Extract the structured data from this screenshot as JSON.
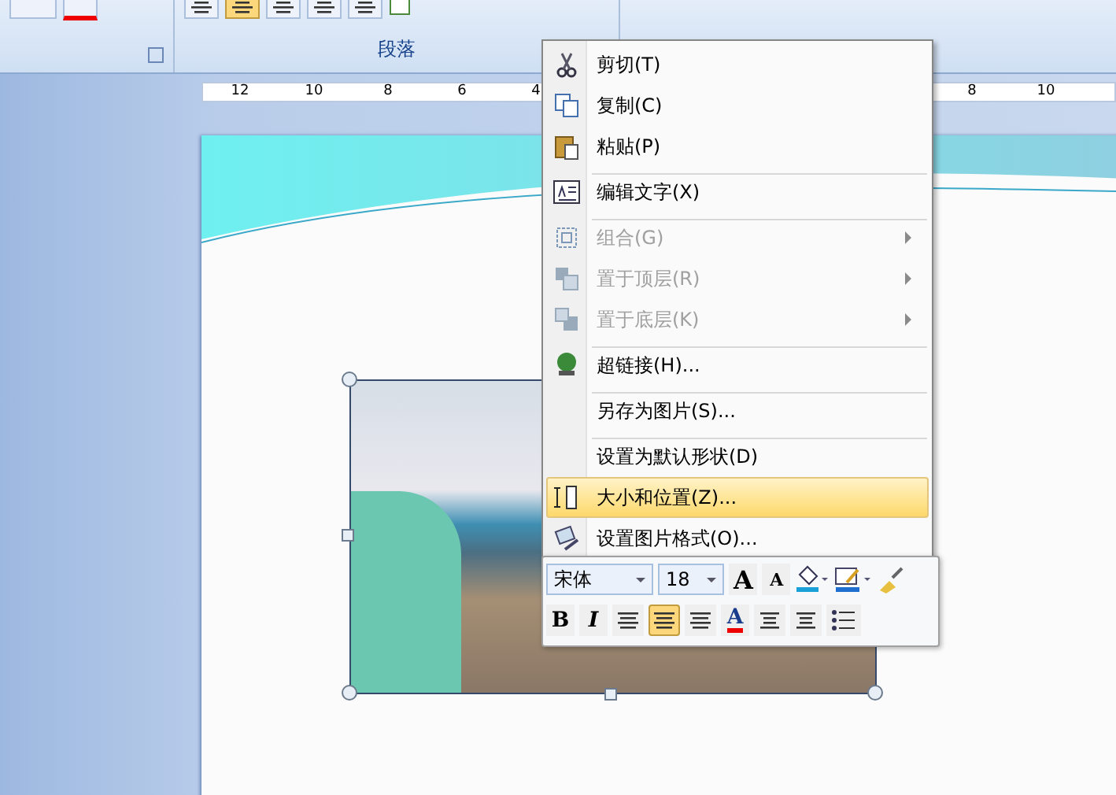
{
  "ribbon": {
    "align_buttons": [
      {
        "selected": false
      },
      {
        "selected": true
      },
      {
        "selected": false
      },
      {
        "selected": false
      },
      {
        "selected": false
      }
    ],
    "group_label": "段落"
  },
  "ruler": {
    "left_ticks": [
      "12",
      "10",
      "8",
      "6",
      "4"
    ],
    "right_ticks": [
      "8",
      "10"
    ]
  },
  "context_menu": {
    "items": [
      {
        "label": "剪切(T)",
        "disabled": false,
        "submenu": false,
        "selected": false,
        "separator_before": false
      },
      {
        "label": "复制(C)",
        "disabled": false,
        "submenu": false,
        "selected": false,
        "separator_before": false
      },
      {
        "label": "粘贴(P)",
        "disabled": false,
        "submenu": false,
        "selected": false,
        "separator_before": false
      },
      {
        "label": "编辑文字(X)",
        "disabled": false,
        "submenu": false,
        "selected": false,
        "separator_before": true
      },
      {
        "label": "组合(G)",
        "disabled": true,
        "submenu": true,
        "selected": false,
        "separator_before": true
      },
      {
        "label": "置于顶层(R)",
        "disabled": true,
        "submenu": true,
        "selected": false,
        "separator_before": false
      },
      {
        "label": "置于底层(K)",
        "disabled": true,
        "submenu": true,
        "selected": false,
        "separator_before": false
      },
      {
        "label": "超链接(H)...",
        "disabled": false,
        "submenu": false,
        "selected": false,
        "separator_before": true
      },
      {
        "label": "另存为图片(S)...",
        "disabled": false,
        "submenu": false,
        "selected": false,
        "separator_before": true
      },
      {
        "label": "设置为默认形状(D)",
        "disabled": false,
        "submenu": false,
        "selected": false,
        "separator_before": true
      },
      {
        "label": "大小和位置(Z)...",
        "disabled": false,
        "submenu": false,
        "selected": true,
        "separator_before": false
      },
      {
        "label": "设置图片格式(O)...",
        "disabled": false,
        "submenu": false,
        "selected": false,
        "separator_before": false
      }
    ]
  },
  "mini_toolbar": {
    "font": "宋体",
    "size": "18",
    "row1": [
      {
        "kind": "grow",
        "glyph": "A"
      },
      {
        "kind": "shrink",
        "glyph": "A"
      },
      {
        "kind": "fill"
      },
      {
        "kind": "line"
      },
      {
        "kind": "painter"
      }
    ],
    "row2": [
      {
        "kind": "bold",
        "glyph": "B",
        "selected": false
      },
      {
        "kind": "italic",
        "glyph": "I",
        "selected": false
      },
      {
        "kind": "align",
        "selected": false
      },
      {
        "kind": "align",
        "selected": true
      },
      {
        "kind": "align",
        "selected": false
      },
      {
        "kind": "fontcolor",
        "glyph": "A",
        "selected": false
      },
      {
        "kind": "outdent",
        "selected": false
      },
      {
        "kind": "indent",
        "selected": false
      },
      {
        "kind": "bullets",
        "selected": false
      }
    ]
  }
}
